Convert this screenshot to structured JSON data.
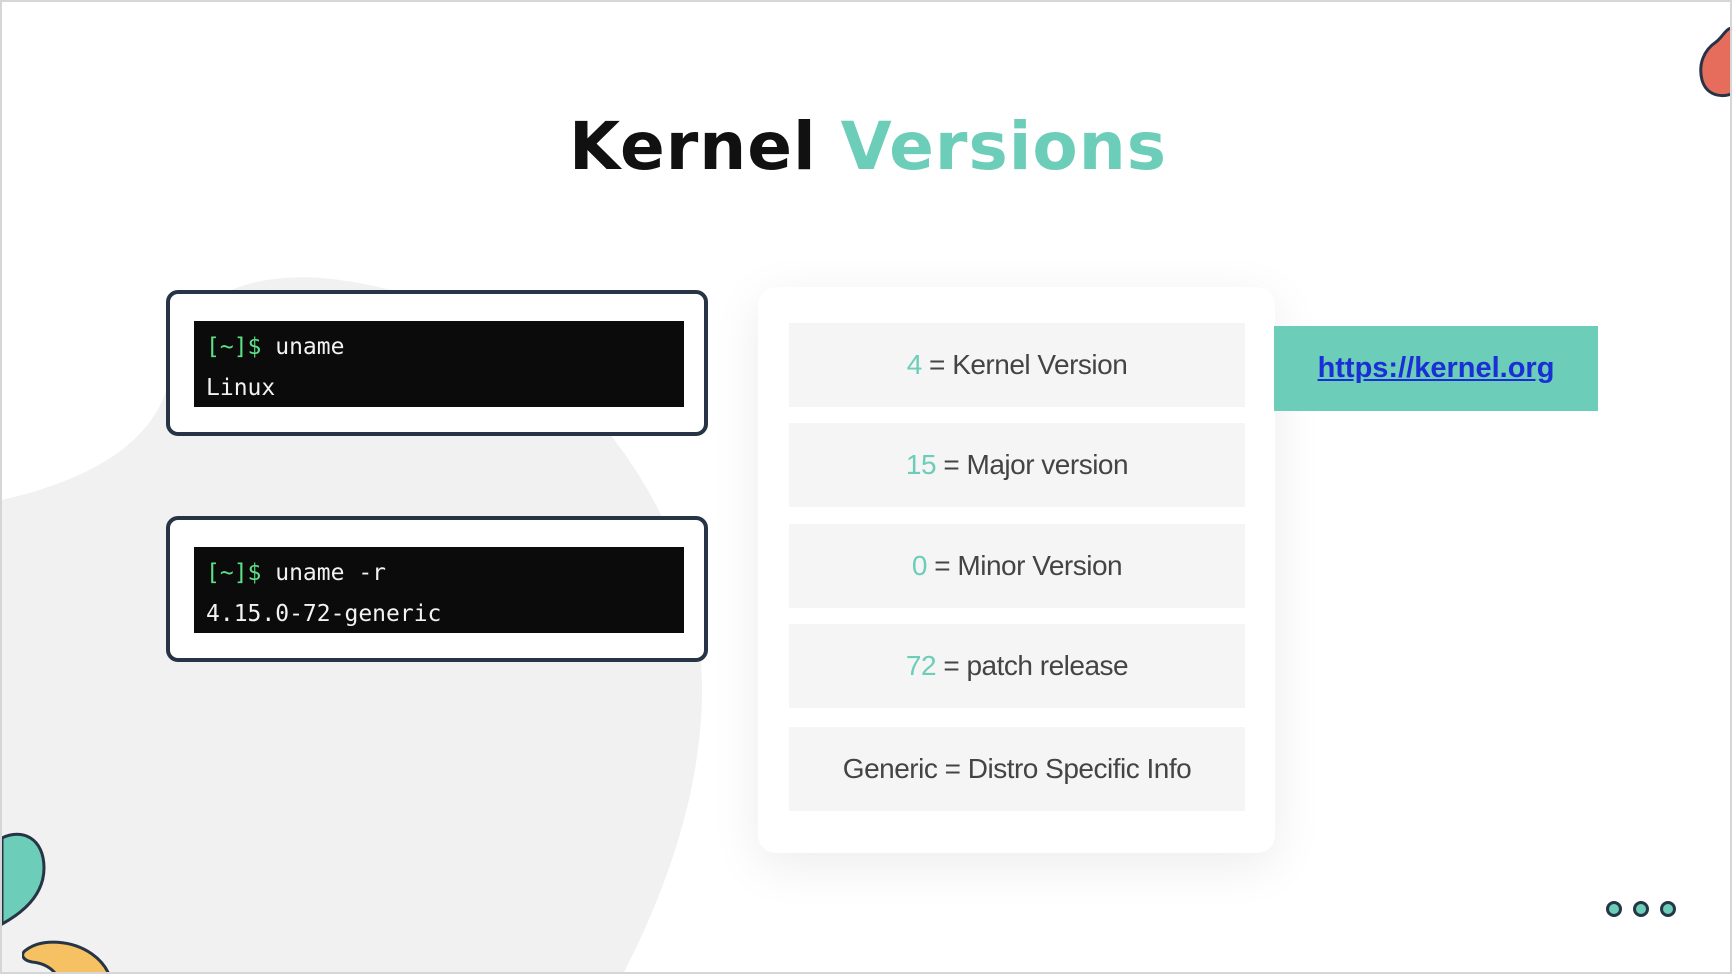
{
  "slide": {
    "title_main": "Kernel",
    "title_accent": "Versions"
  },
  "terminals": [
    {
      "prompt": "[~]$",
      "command": " uname",
      "output": "Linux"
    },
    {
      "prompt": "[~]$",
      "command": " uname -r",
      "output": "4.15.0-72-generic"
    }
  ],
  "version_parts": [
    {
      "value": "4",
      "label": "Kernel Version"
    },
    {
      "value": "15",
      "label": "Major version"
    },
    {
      "value": "0",
      "label": "Minor Version"
    },
    {
      "value": "72",
      "label": "patch release"
    },
    {
      "value": "Generic",
      "label": "Distro Specific Info"
    }
  ],
  "equals": " = ",
  "link": {
    "text": "https://kernel.org",
    "href": "https://kernel.org"
  },
  "colors": {
    "accent": "#6ccdb8",
    "dark": "#263445",
    "prompt_green": "#5ee087",
    "link_blue": "#1a2fd6"
  }
}
